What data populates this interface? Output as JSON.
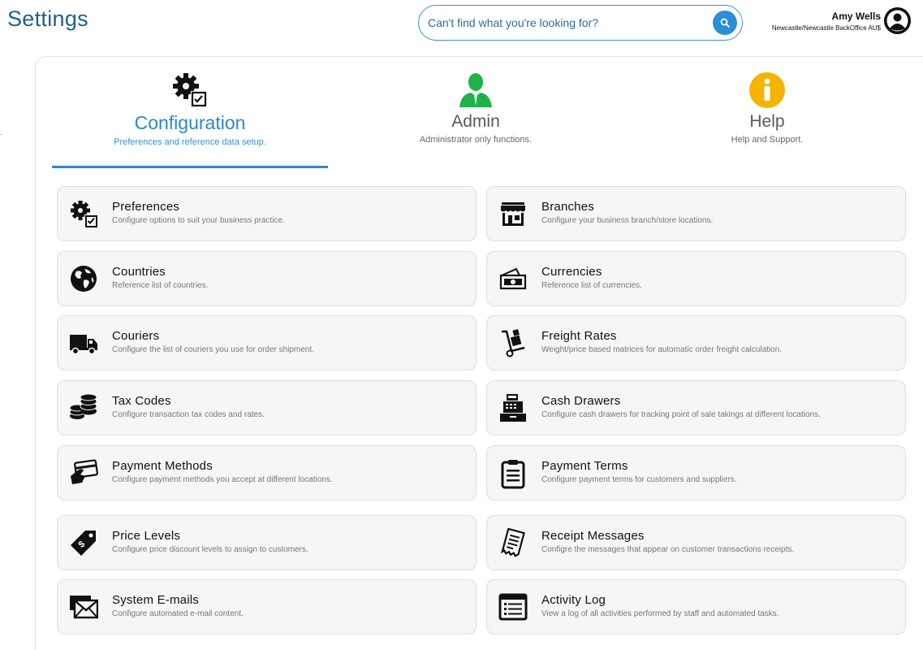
{
  "header": {
    "title": "Settings",
    "search_placeholder": "Can't find what you're looking for?",
    "user_name": "Amy Wells",
    "user_location": "Newcastle/Newcastle BackOffice AU$"
  },
  "tabs": [
    {
      "label": "Configuration",
      "sub": "Preferences and reference data setup.",
      "active": true,
      "icon": "gear-config-icon"
    },
    {
      "label": "Admin",
      "sub": "Administrator only functions.",
      "active": false,
      "icon": "admin-user-icon"
    },
    {
      "label": "Help",
      "sub": "Help and Support.",
      "active": false,
      "icon": "info-icon"
    }
  ],
  "colors": {
    "accent": "#2a87d0",
    "admin_green": "#1fb24a",
    "help_yellow": "#f5b400",
    "card_bg": "#f6f6f6"
  },
  "cards": [
    {
      "title": "Preferences",
      "desc": "Configure options to suit your business practice.",
      "icon": "gear-config-icon"
    },
    {
      "title": "Branches",
      "desc": "Configure your business branch/store locations.",
      "icon": "store-icon"
    },
    {
      "title": "Countries",
      "desc": "Reference list of countries.",
      "icon": "globe-icon"
    },
    {
      "title": "Currencies",
      "desc": "Reference list of currencies.",
      "icon": "money-icon"
    },
    {
      "title": "Couriers",
      "desc": "Configure the list of couriers you use for order shipment.",
      "icon": "truck-icon"
    },
    {
      "title": "Freight Rates",
      "desc": "Weight/price based matrices for automatic order freight calculation.",
      "icon": "hand-truck-icon"
    },
    {
      "title": "Tax Codes",
      "desc": "Configure transaction tax codes and rates.",
      "icon": "coins-icon"
    },
    {
      "title": "Cash Drawers",
      "desc": "Configure cash drawers for tracking point of sale takings at different locations.",
      "icon": "cash-register-icon"
    },
    {
      "title": "Payment Methods",
      "desc": "Configure payment methods you accept at different locations.",
      "icon": "card-payment-icon"
    },
    {
      "title": "Payment Terms",
      "desc": "Configure payment terms for customers and suppliers.",
      "icon": "clipboard-icon"
    },
    {
      "title": "Price Levels",
      "desc": "Configure price discount levels to assign to customers.",
      "icon": "price-tag-icon"
    },
    {
      "title": "Receipt Messages",
      "desc": "Configre the messages that appear on customer transactions receipts.",
      "icon": "receipt-icon"
    },
    {
      "title": "System E-mails",
      "desc": "Configure automated e-mail content.",
      "icon": "email-icon"
    },
    {
      "title": "Activity Log",
      "desc": "View a log of all activities performed by staff and automated tasks.",
      "icon": "list-log-icon"
    }
  ]
}
